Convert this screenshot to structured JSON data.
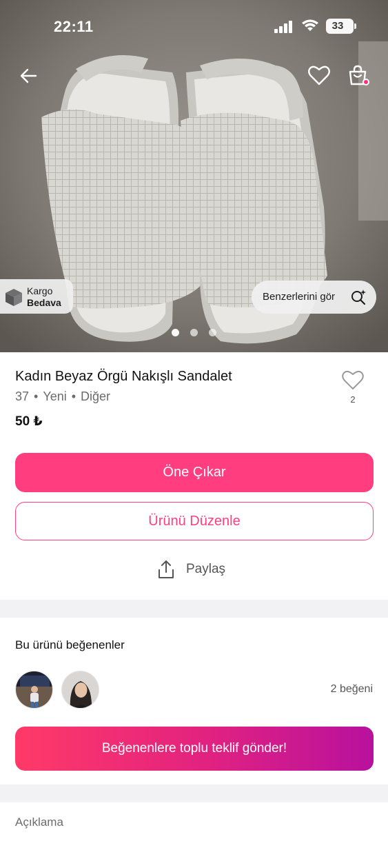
{
  "status_bar": {
    "time": "22:11",
    "battery": "33"
  },
  "hero": {
    "cargo_badge": {
      "line1": "Kargo",
      "line2": "Bedava"
    },
    "similar_button": "Benzerlerini gör",
    "image_count": 3,
    "active_image": 1
  },
  "product": {
    "title": "Kadın Beyaz Örgü Nakışlı Sandalet",
    "size": "37",
    "condition": "Yeni",
    "brand": "Diğer",
    "price": "50 ₺",
    "like_count": "2"
  },
  "actions": {
    "promote_label": "Öne Çıkar",
    "edit_label": "Ürünü Düzenle",
    "share_label": "Paylaş"
  },
  "likers": {
    "title": "Bu ürünü beğenenler",
    "count_text": "2 beğeni",
    "bulk_offer_label": "Beğenenlere toplu teklif gönder!"
  },
  "description": {
    "label": "Açıklama"
  },
  "colors": {
    "accent": "#ff3d7f",
    "gradient_start": "#ff3a68",
    "gradient_end": "#b8119e"
  }
}
